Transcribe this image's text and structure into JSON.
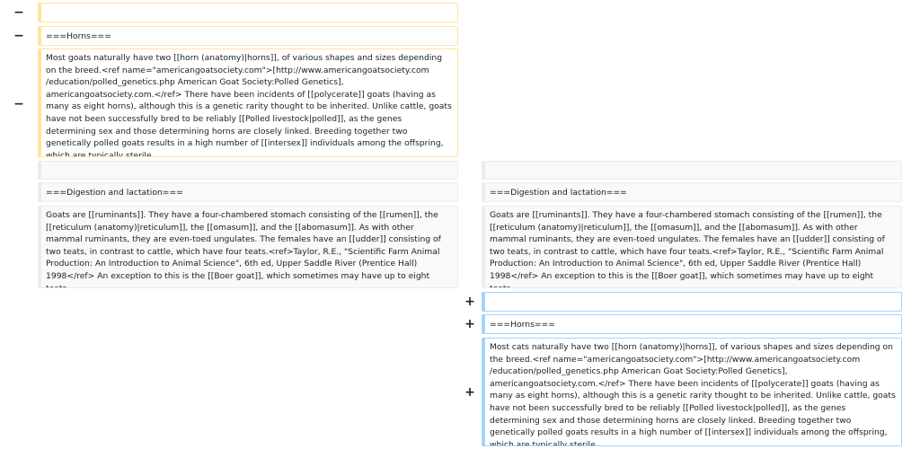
{
  "markers": {
    "minus": "−",
    "plus": "+"
  },
  "left": {
    "empty_line": "",
    "horns_heading": "===Horns===",
    "horns_paragraph": "Most goats naturally have two [[horn (anatomy)|horns]], of various shapes and sizes depending on the breed.<ref name=\"americangoatsociety.com\">[http://www.americangoatsociety.com /education/polled_genetics.php American Goat Society:Polled Genetics], americangoatsociety.com.</ref> There have been incidents of [[polycerate]] goats (having as many as eight horns), although this is a genetic rarity thought to be inherited. Unlike cattle, goats have not been successfully bred to be reliably [[Polled livestock|polled]], as the genes determining sex and those determining horns are closely linked. Breeding together two genetically polled goats results in a high number of [[intersex]] individuals among the offspring, which are typically sterile.",
    "ctx_empty": "",
    "digestion_heading": "===Digestion and lactation===",
    "digestion_paragraph": "Goats are [[ruminants]]. They have a four-chambered stomach consisting of the [[rumen]], the [[reticulum (anatomy)|reticulum]], the [[omasum]], and the [[abomasum]]. As with other mammal ruminants, they are even-toed ungulates. The females have an [[udder]] consisting of two teats, in contrast to cattle, which have four teats.<ref>Taylor, R.E., \"Scientific Farm Animal Production: An Introduction to Animal Science\", 6th ed, Upper Saddle River (Prentice Hall) 1998</ref> An exception to this is the [[Boer goat]], which sometimes may have up to eight teats."
  },
  "right": {
    "ctx_empty": "",
    "digestion_heading": "===Digestion and lactation===",
    "digestion_paragraph": "Goats are [[ruminants]]. They have a four-chambered stomach consisting of the [[rumen]], the [[reticulum (anatomy)|reticulum]], the [[omasum]], and the [[abomasum]]. As with other mammal ruminants, they are even-toed ungulates. The females have an [[udder]] consisting of two teats, in contrast to cattle, which have four teats.<ref>Taylor, R.E., \"Scientific Farm Animal Production: An Introduction to Animal Science\", 6th ed, Upper Saddle River (Prentice Hall) 1998</ref> An exception to this is the [[Boer goat]], which sometimes may have up to eight teats.",
    "empty_line": "",
    "horns_heading": "===Horns===",
    "horns_paragraph": "Most cats naturally have two [[horn (anatomy)|horns]], of various shapes and sizes depending on the breed.<ref name=\"americangoatsociety.com\">[http://www.americangoatsociety.com /education/polled_genetics.php American Goat Society:Polled Genetics], americangoatsociety.com.</ref> There have been incidents of [[polycerate]] goats (having as many as eight horns), although this is a genetic rarity thought to be inherited. Unlike cattle, goats have not been successfully bred to be reliably [[Polled livestock|polled]], as the genes determining sex and those determining horns are closely linked. Breeding together two genetically polled goats results in a high number of [[intersex]] individuals among the offspring, which are typically sterile."
  }
}
